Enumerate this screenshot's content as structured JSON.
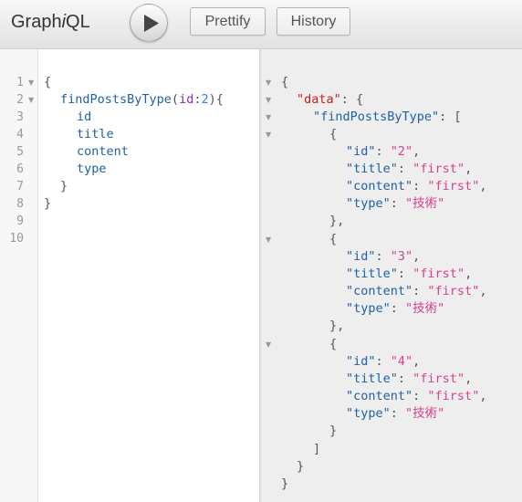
{
  "app": {
    "logo_prefix": "Graph",
    "logo_italic": "i",
    "logo_suffix": "QL"
  },
  "toolbar": {
    "execute_icon": "play-icon",
    "prettify_label": "Prettify",
    "history_label": "History"
  },
  "query_editor": {
    "line_numbers": [
      "1",
      "2",
      "3",
      "4",
      "5",
      "6",
      "7",
      "8",
      "9",
      "10"
    ],
    "lines": {
      "l1_brace": "{",
      "l2_field": "findPostsByType",
      "l2_paren_open": "(",
      "l2_arg": "id",
      "l2_colon": ":",
      "l2_value": "2",
      "l2_paren_close": "){",
      "l3_field": "id",
      "l4_field": "title",
      "l5_field": "content",
      "l6_field": "type",
      "l7_brace": "}",
      "l8_brace": "}"
    }
  },
  "result_viewer": {
    "open_brace": "{",
    "data_key": "\"data\"",
    "colon_brace": ": {",
    "query_key": "\"findPostsByType\"",
    "colon_bracket": ": [",
    "posts": [
      {
        "id": "\"2\"",
        "title": "\"first\"",
        "content": "\"first\"",
        "type": "\"技術\""
      },
      {
        "id": "\"3\"",
        "title": "\"first\"",
        "content": "\"first\"",
        "type": "\"技術\""
      },
      {
        "id": "\"4\"",
        "title": "\"first\"",
        "content": "\"first\"",
        "type": "\"技術\""
      }
    ],
    "keys": {
      "id": "\"id\"",
      "title": "\"title\"",
      "content": "\"content\"",
      "type": "\"type\""
    },
    "close_bracket": "]",
    "close_inner": "}",
    "close_outer": "}"
  }
}
